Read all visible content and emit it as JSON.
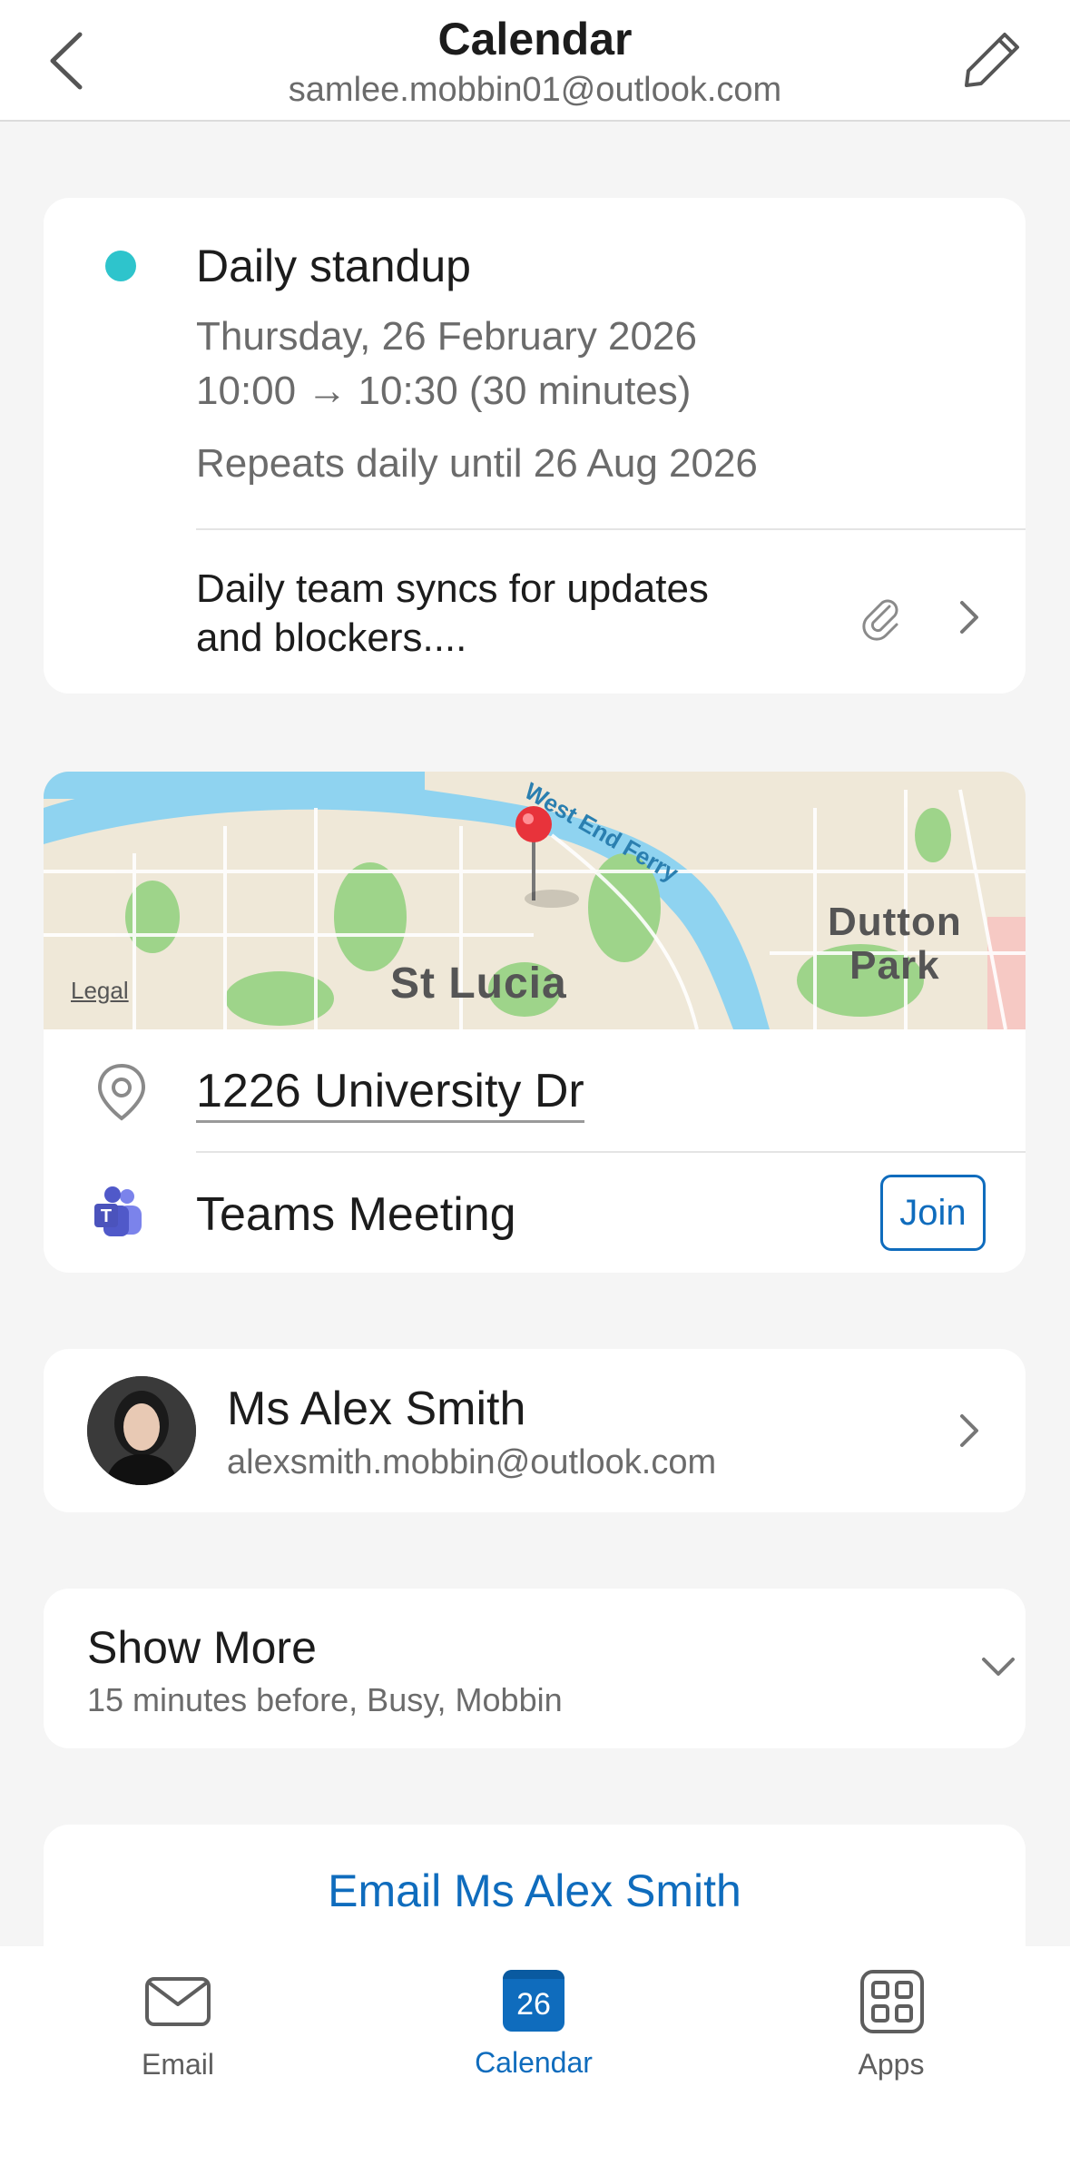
{
  "header": {
    "title": "Calendar",
    "account": "samlee.mobbin01@outlook.com",
    "back_icon": "chevron-left-icon",
    "edit_icon": "pencil-icon"
  },
  "event": {
    "title": "Daily standup",
    "color": "#2ec4cc",
    "date": "Thursday, 26 February 2026",
    "time": "10:00 → 10:30 (30 minutes)",
    "repeat": "Repeats daily until 26 Aug 2026",
    "notes": "Daily team syncs for updates and blockers....",
    "attachment_icon": "paperclip-icon",
    "chevron_icon": "chevron-right-icon"
  },
  "map": {
    "labels": {
      "area": "St Lucia",
      "area2_line1": "Dutton",
      "area2_line2": "Park",
      "ferry": "West End Ferry"
    },
    "legal": "Legal"
  },
  "location": {
    "address": "1226 University Dr",
    "icon": "location-pin-icon"
  },
  "teams": {
    "label": "Teams Meeting",
    "join_label": "Join",
    "icon": "teams-icon"
  },
  "attendee": {
    "name": "Ms Alex Smith",
    "email": "alexsmith.mobbin@outlook.com"
  },
  "show_more": {
    "title": "Show More",
    "summary": "15 minutes before, Busy, Mobbin"
  },
  "email_action": {
    "label": "Email Ms Alex Smith"
  },
  "tabbar": {
    "email": "Email",
    "calendar": "Calendar",
    "calendar_day": "26",
    "apps": "Apps",
    "active_color": "#0f6cbd"
  }
}
